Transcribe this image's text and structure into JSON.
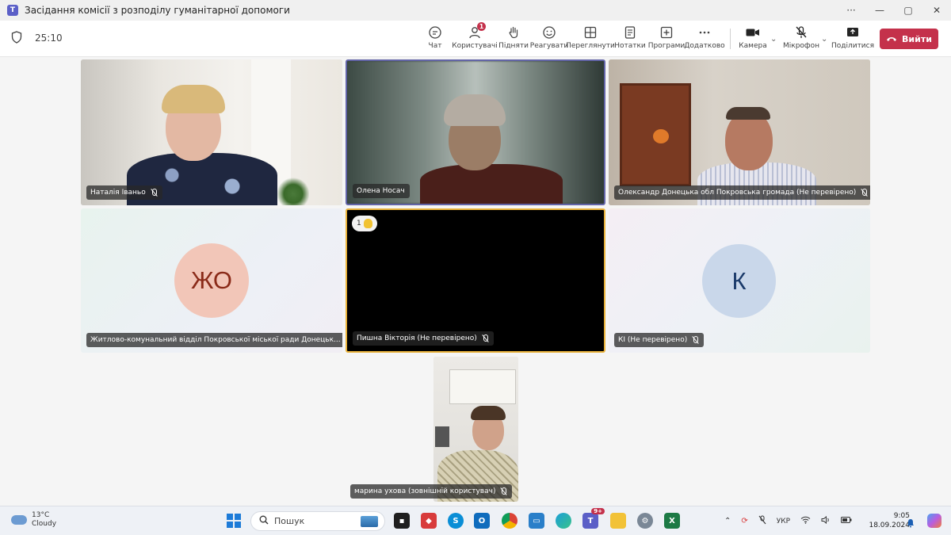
{
  "window": {
    "title": "Засідання комісії з розподілу гуманітарної допомоги",
    "app_icon": "T",
    "controls": [
      "···",
      "—",
      "▢",
      "✕"
    ]
  },
  "toolbar": {
    "timer": "25:10",
    "buttons": [
      {
        "label": "Чат",
        "icon": "chat-icon"
      },
      {
        "label": "Користувачі",
        "icon": "people-icon",
        "badge": "1"
      },
      {
        "label": "Підняти",
        "icon": "raise-hand-icon"
      },
      {
        "label": "Реагувати",
        "icon": "react-icon"
      },
      {
        "label": "Переглянути",
        "icon": "view-icon"
      },
      {
        "label": "Нотатки",
        "icon": "notes-icon"
      },
      {
        "label": "Програми",
        "icon": "apps-icon"
      },
      {
        "label": "Додатково",
        "icon": "more-icon"
      },
      {
        "label": "Камера",
        "icon": "camera-icon"
      },
      {
        "label": "Мікрофон",
        "icon": "mic-off-icon"
      },
      {
        "label": "Поділитися",
        "icon": "share-icon"
      }
    ],
    "leave_label": "Вийти"
  },
  "participants": [
    {
      "name": "Наталія Іваньо",
      "type": "video"
    },
    {
      "name": "Олена Носач",
      "type": "video"
    },
    {
      "name": "Олександр Донецька обл Покровська громада (Не перевірено)",
      "type": "video"
    },
    {
      "name": "Житлово-комунальний відділ Покровської міської ради Донецьк...",
      "type": "avatar",
      "initials": "ЖО"
    },
    {
      "name": "Пишна Вікторія (Не перевірено)",
      "type": "video",
      "raised_hand": "1"
    },
    {
      "name": "КІ (Не перевірено)",
      "type": "avatar",
      "initials": "К"
    },
    {
      "name": "марина ухова (зовнішній користувач)",
      "type": "video"
    }
  ],
  "colors": {
    "accent": "#5b5fc7",
    "leave": "#c4314b",
    "active_speaker_border": "#6264a7",
    "raised_hand_border": "#e8b13a"
  },
  "taskbar": {
    "weather_temp": "13°C",
    "weather_desc": "Cloudy",
    "search_placeholder": "Пошук",
    "teams_badge": "9+",
    "lang": "УКР",
    "time": "9:05",
    "date": "18.09.2024"
  }
}
